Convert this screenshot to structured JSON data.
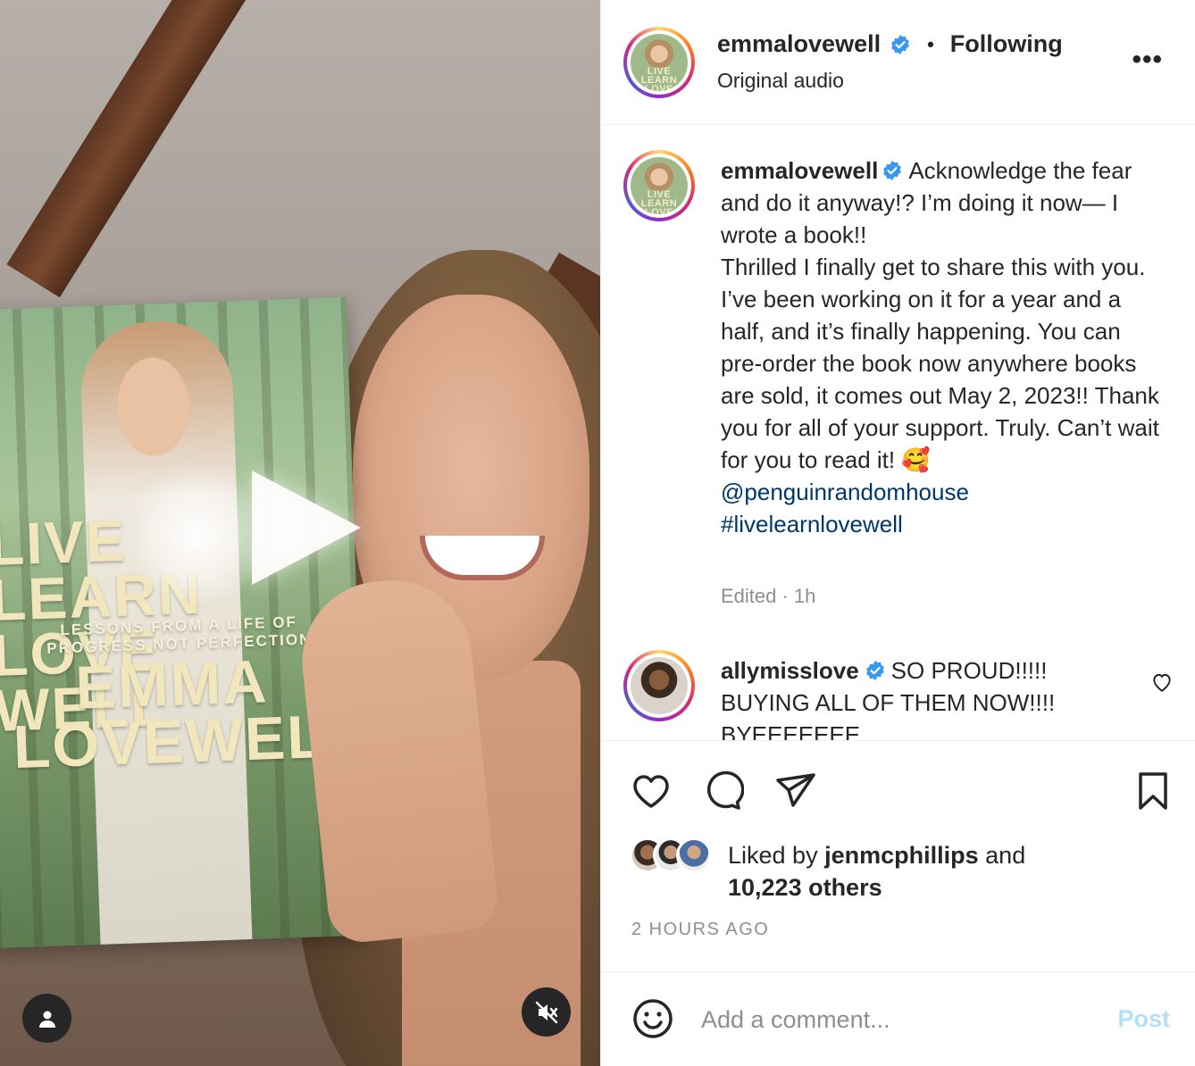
{
  "post": {
    "book_cover": {
      "title": "LIVE LEARN LOVE WELL",
      "subtitle": "LESSONS FROM A LIFE OF PROGRESS NOT PERFECTION",
      "author": "EMMA LOVEWELL"
    },
    "avatar_lettering": "LIVE LEARN LOVE WELL"
  },
  "header": {
    "username": "emmalovewell",
    "separator": "•",
    "follow_status": "Following",
    "audio_label": "Original audio",
    "more_label": "•••"
  },
  "caption": {
    "username": "emmalovewell",
    "text": "Acknowledge the fear and do it anyway!? I’m doing it now— I wrote a book!!",
    "text2": "Thrilled I finally get to share this with you. I’ve been working on it for a year and a half, and it’s finally happening. You can pre-order the book now anywhere books are sold, it comes out May 2, 2023!! Thank you for all of your support. Truly. Can’t wait for you to read it! 🥰",
    "mention": "@penguinrandomhouse",
    "hashtag": "#livelearnlovewell",
    "meta": "Edited · 1h"
  },
  "comment": {
    "username": "allymisslove",
    "text": "SO PROUD!!!!! BUYING ALL OF THEM NOW!!!! BYEEEEEEE"
  },
  "likes": {
    "prefix": "Liked by",
    "user": "jenmcphillips",
    "and": "and",
    "count": "10,223 others"
  },
  "timestamp": "2 HOURS AGO",
  "composer": {
    "placeholder": "Add a comment...",
    "post_label": "Post"
  },
  "colors": {
    "verified": "#3897f0",
    "link": "#00376b",
    "post_disabled": "#b2dffc",
    "muted": "#8e8e8e"
  },
  "icons": [
    "play-icon",
    "user-tag-icon",
    "muted-speaker-icon",
    "more-icon",
    "verified-icon",
    "heart-icon",
    "comment-icon",
    "share-icon",
    "bookmark-icon",
    "emoji-icon"
  ]
}
